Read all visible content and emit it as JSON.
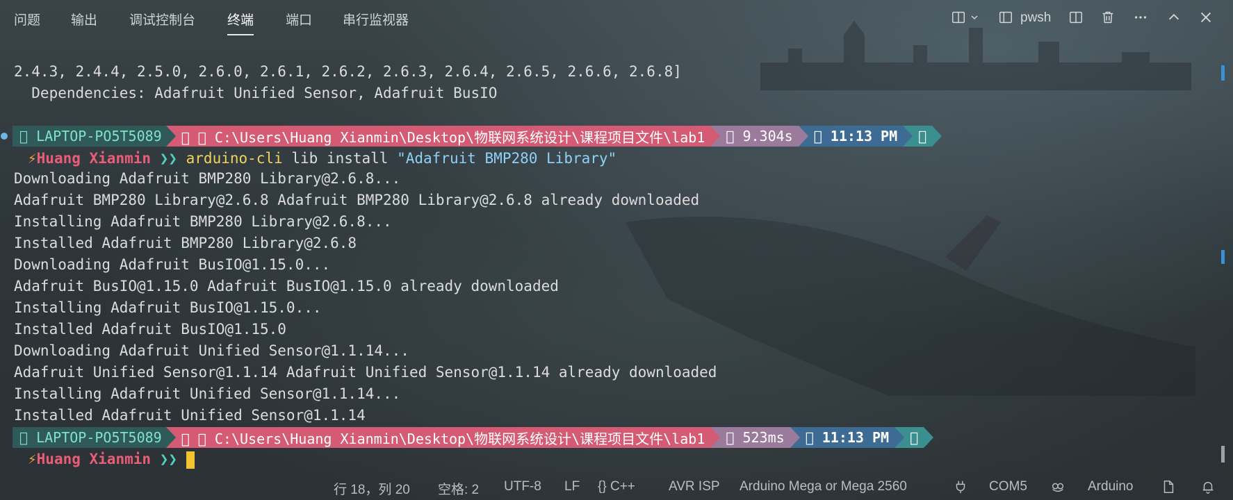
{
  "tabs": [
    {
      "label": "问题"
    },
    {
      "label": "输出"
    },
    {
      "label": "调试控制台"
    },
    {
      "label": "终端"
    },
    {
      "label": "端口"
    },
    {
      "label": "串行监视器"
    }
  ],
  "active_tab": "终端",
  "header": {
    "shell_label": "pwsh",
    "icons": [
      "split-layout-icon",
      "chevron-down-icon",
      "terminal-icon",
      "split-terminal-icon",
      "trash-icon",
      "more-icon",
      "chevron-up-icon",
      "close-icon"
    ]
  },
  "terminal": {
    "pre_lines": [
      "2.4.3, 2.4.4, 2.5.0, 2.6.0, 2.6.1, 2.6.2, 2.6.3, 2.6.4, 2.6.5, 2.6.6, 2.6.8]",
      "  Dependencies: Adafruit Unified Sensor, Adafruit BusIO"
    ],
    "prompt1": {
      "host": "󰌢 LAPTOP-PO5T5089",
      "path": "󰉋 󰉋 C:\\Users\\Huang Xianmin\\Desktop\\物联网系统设计\\课程项目文件\\lab1",
      "duration": "󰔟 9.304s",
      "clock": "󰥔 11:13 PM",
      "end": "󰀄"
    },
    "command": {
      "bolt": "⚡",
      "user": "Huang Xianmin",
      "chevron": "❯❯",
      "cmd": "arduino-cli",
      "args": "lib install",
      "string": "\"Adafruit BMP280 Library\""
    },
    "output_lines": [
      "Downloading Adafruit BMP280 Library@2.6.8...",
      "Adafruit BMP280 Library@2.6.8 Adafruit BMP280 Library@2.6.8 already downloaded",
      "Installing Adafruit BMP280 Library@2.6.8...",
      "Installed Adafruit BMP280 Library@2.6.8",
      "Downloading Adafruit BusIO@1.15.0...",
      "Adafruit BusIO@1.15.0 Adafruit BusIO@1.15.0 already downloaded",
      "Installing Adafruit BusIO@1.15.0...",
      "Installed Adafruit BusIO@1.15.0",
      "Downloading Adafruit Unified Sensor@1.1.14...",
      "Adafruit Unified Sensor@1.1.14 Adafruit Unified Sensor@1.1.14 already downloaded",
      "Installing Adafruit Unified Sensor@1.1.14...",
      "Installed Adafruit Unified Sensor@1.1.14"
    ],
    "prompt2": {
      "host": "󰌢 LAPTOP-PO5T5089",
      "path": "󰉋 󰉋 C:\\Users\\Huang Xianmin\\Desktop\\物联网系统设计\\课程项目文件\\lab1",
      "duration": "󰔟 523ms",
      "clock": "󰥔 11:13 PM",
      "end": "󰀄"
    },
    "final_prompt": {
      "bolt": "⚡",
      "user": "Huang Xianmin",
      "chevron": "❯❯"
    }
  },
  "statusbar": {
    "position": "行 18，列 20",
    "indent": "空格: 2",
    "encoding": "UTF-8",
    "eol": "LF",
    "language_braces": "{}",
    "language": "C++",
    "programmer": "AVR ISP",
    "board": "Arduino Mega or Mega 2560",
    "port": "COM5",
    "extension": "Arduino"
  },
  "colors": {
    "host_bg": "#30595a",
    "path_bg": "#d45b73",
    "duration_bg": "#9a7b9b",
    "clock_bg": "#3d6b93",
    "end_bg": "#3b8f8f",
    "command_yellow": "#f2d35b",
    "string_blue": "#8fd0f7"
  }
}
